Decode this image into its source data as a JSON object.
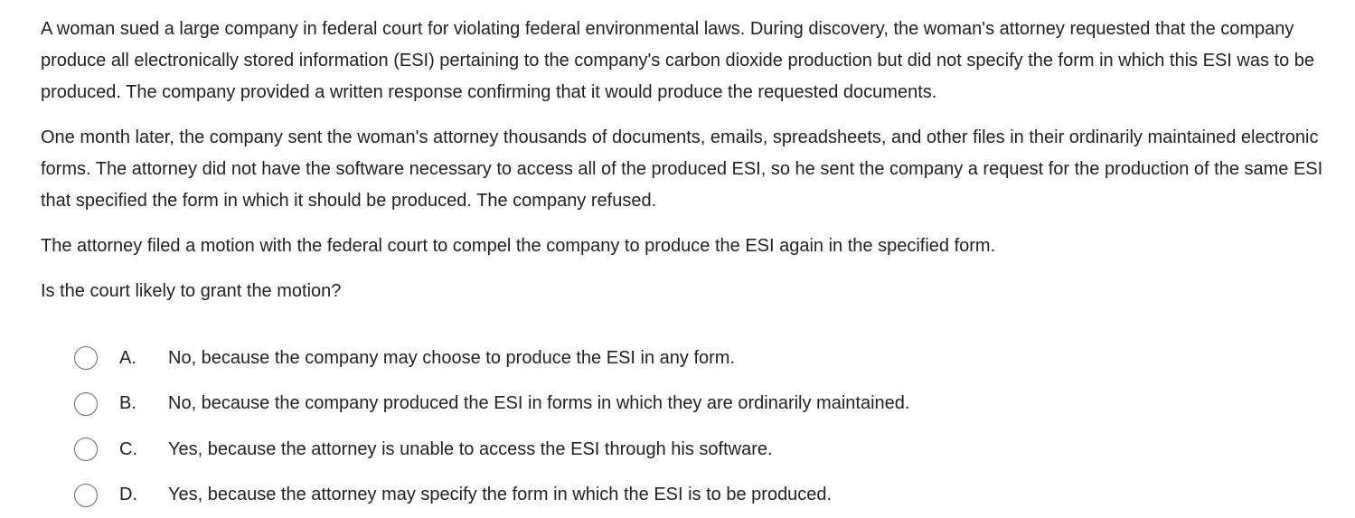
{
  "question": {
    "paragraphs": [
      "A woman sued a large company in federal court for violating federal environmental laws.  During discovery, the woman's attorney requested that the company produce all electronically stored information (ESI) pertaining to the company's carbon dioxide production but did not specify the form in which this ESI was to be produced.  The company provided a written response confirming that it would produce the requested documents.",
      "One month later, the company sent the woman's attorney thousands of documents, emails, spreadsheets, and other files in their ordinarily maintained electronic forms.  The attorney did not have the software necessary to access all of the produced ESI, so he sent the company a request for the production of the same ESI that specified the form in which it should be produced.  The company refused.",
      "The attorney filed a motion with the federal court to compel the company to produce the ESI again in the specified form.",
      "Is the court likely to grant the motion?"
    ]
  },
  "choices": [
    {
      "letter": "A.",
      "text": "No, because the company may choose to produce the ESI in any form."
    },
    {
      "letter": "B.",
      "text": "No, because the company produced the ESI in forms in which they are ordinarily maintained."
    },
    {
      "letter": "C.",
      "text": "Yes, because the attorney is unable to access the ESI through his software."
    },
    {
      "letter": "D.",
      "text": "Yes, because the attorney may specify the form in which the ESI is to be produced."
    }
  ]
}
